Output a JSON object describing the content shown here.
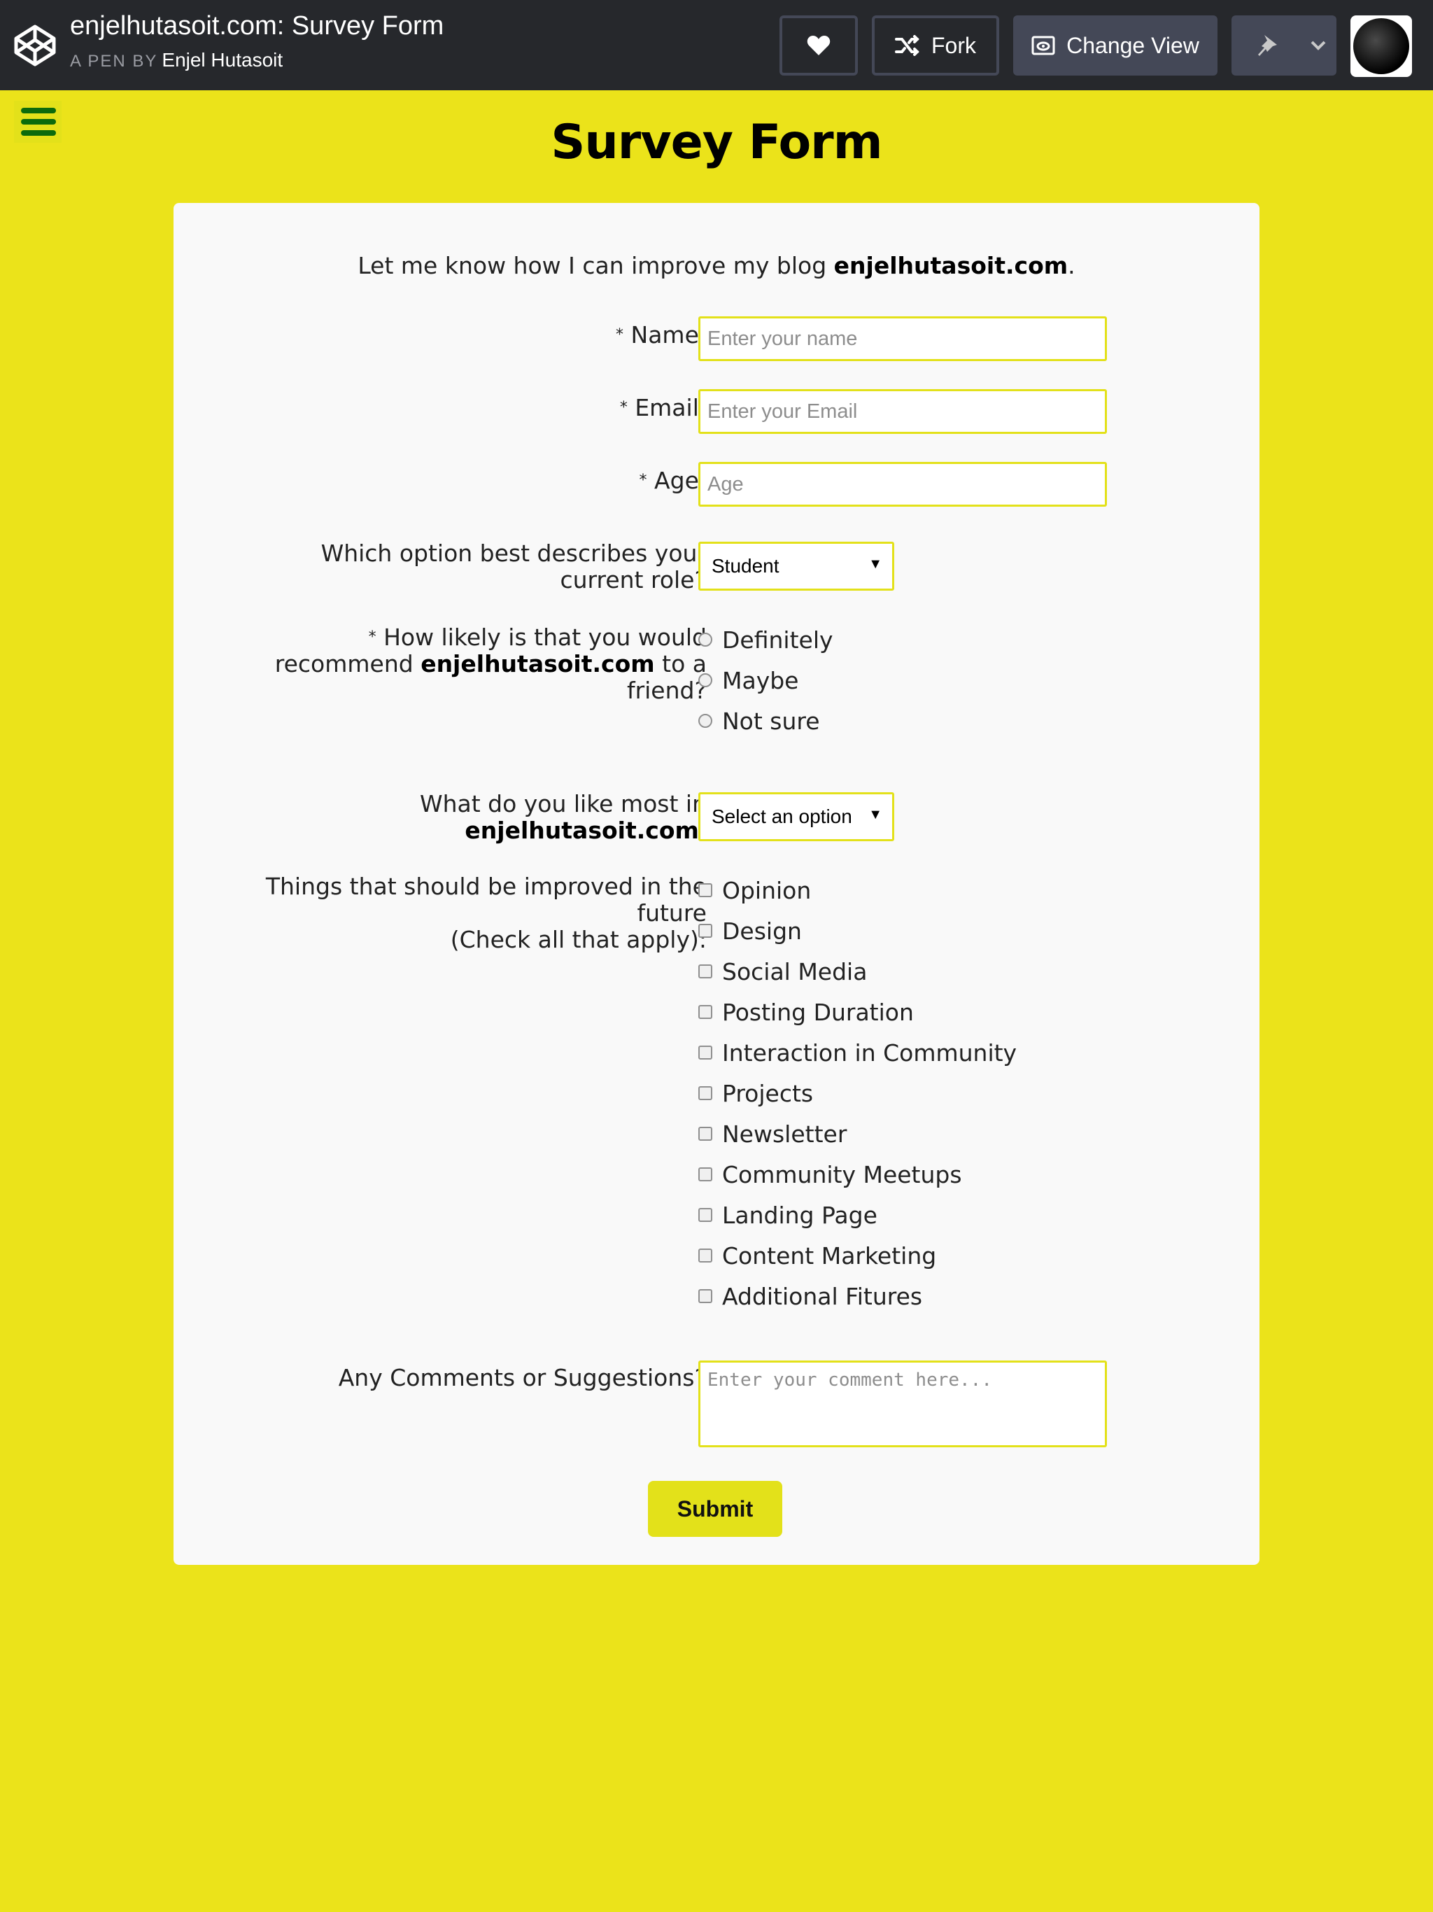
{
  "codepen": {
    "title": "enjelhutasoit.com: Survey Form",
    "pen_by": "A PEN BY",
    "author": "Enjel Hutasoit",
    "fork_label": "Fork",
    "change_view_label": "Change View"
  },
  "page": {
    "title": "Survey Form",
    "intro_prefix": "Let me know how I can improve my blog ",
    "intro_site": "enjelhutasoit.com",
    "intro_suffix": "."
  },
  "form": {
    "required_mark": "*",
    "name_label": "Name:",
    "name_placeholder": "Enter your name",
    "email_label": "Email:",
    "email_placeholder": "Enter your Email",
    "age_label": "Age:",
    "age_placeholder": "Age",
    "role_label_line1": "Which option best describes your",
    "role_label_line2": "current role?",
    "role_selected": "Student",
    "recommend_label_line1": "How likely is that you would",
    "recommend_label_pre": "recommend ",
    "recommend_label_site": "enjelhutasoit.com",
    "recommend_label_post": " to a",
    "recommend_label_line3": "friend?",
    "recommend_options": [
      "Definitely",
      "Maybe",
      "Not sure"
    ],
    "like_label_line1": "What do you like most in",
    "like_label_site": "enjelhutasoit.com",
    "like_label_colon": ":",
    "like_selected": "Select an option",
    "improve_label_line1": "Things that should be improved in the",
    "improve_label_line2": "future",
    "improve_label_line3": "(Check all that apply):",
    "improve_options": [
      "Opinion",
      "Design",
      "Social Media",
      "Posting Duration",
      "Interaction in Community",
      "Projects",
      "Newsletter",
      "Community Meetups",
      "Landing Page",
      "Content Marketing",
      "Additional Fitures"
    ],
    "comments_label": "Any Comments or Suggestions?",
    "comments_placeholder": "Enter your comment here...",
    "submit_label": "Submit"
  },
  "colors": {
    "page_background": "#ebe31a",
    "topbar_background": "#26282c",
    "input_border": "#e3e11a",
    "hamburger": "#0c6b0c"
  },
  "icons": [
    "codepen-logo-icon",
    "heart-icon",
    "fork-icon",
    "eye-icon",
    "pin-icon",
    "chevron-down-icon",
    "hamburger-menu-icon"
  ]
}
